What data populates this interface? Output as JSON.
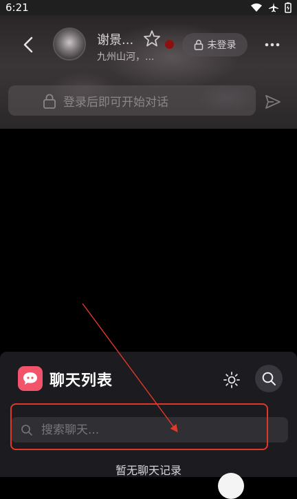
{
  "status_bar": {
    "time": "6:21"
  },
  "chat_header": {
    "name": "谢景...",
    "subtitle": "九州山河，...",
    "login_label": "未登录"
  },
  "chat_input": {
    "placeholder": "登录后即可开始对话"
  },
  "chat_list": {
    "title": "聊天列表",
    "search_placeholder": "搜索聊天...",
    "empty_text": "暂无聊天记录"
  },
  "colors": {
    "accent": "#f2556b",
    "online_dot": "#8d1010",
    "annotation": "#e0382a"
  }
}
